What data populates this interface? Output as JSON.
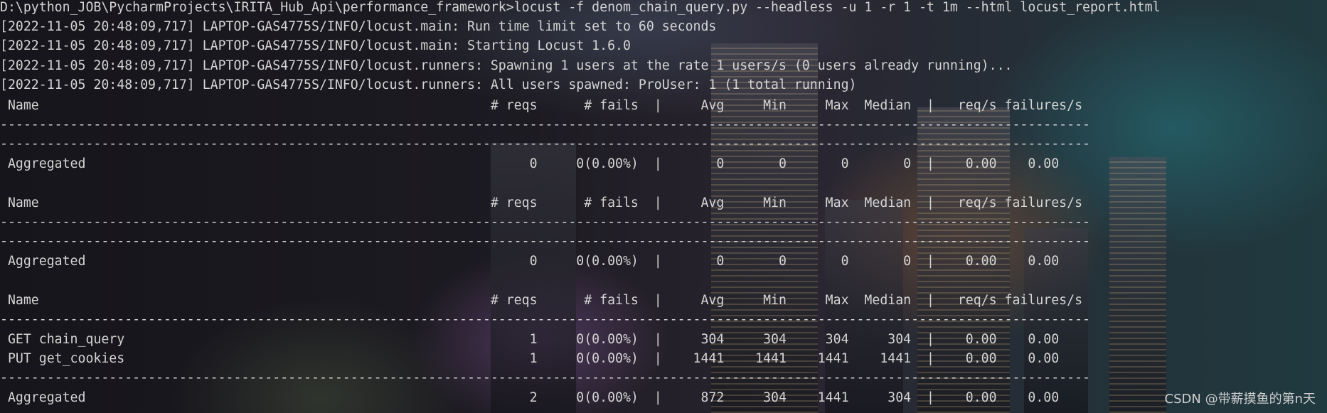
{
  "terminal": {
    "lines": [
      "D:\\python_JOB\\PycharmProjects\\IRITA_Hub_Api\\performance_framework>locust -f denom_chain_query.py --headless -u 1 -r 1 -t 1m --html locust_report.html",
      "[2022-11-05 20:48:09,717] LAPTOP-GAS4775S/INFO/locust.main: Run time limit set to 60 seconds",
      "[2022-11-05 20:48:09,717] LAPTOP-GAS4775S/INFO/locust.main: Starting Locust 1.6.0",
      "[2022-11-05 20:48:09,717] LAPTOP-GAS4775S/INFO/locust.runners: Spawning 1 users at the rate 1 users/s (0 users already running)...",
      "[2022-11-05 20:48:09,717] LAPTOP-GAS4775S/INFO/locust.runners: All users spawned: ProUser: 1 (1 total running)",
      " Name                                                          # reqs      # fails  |     Avg     Min     Max  Median  |   req/s failures/s",
      "--------------------------------------------------------------------------------------------------------------------------------------------",
      "--------------------------------------------------------------------------------------------------------------------------------------------",
      " Aggregated                                                         0     0(0.00%)  |       0       0       0       0  |    0.00    0.00",
      "",
      " Name                                                          # reqs      # fails  |     Avg     Min     Max  Median  |   req/s failures/s",
      "--------------------------------------------------------------------------------------------------------------------------------------------",
      "--------------------------------------------------------------------------------------------------------------------------------------------",
      " Aggregated                                                         0     0(0.00%)  |       0       0       0       0  |    0.00    0.00",
      "",
      " Name                                                          # reqs      # fails  |     Avg     Min     Max  Median  |   req/s failures/s",
      "--------------------------------------------------------------------------------------------------------------------------------------------",
      " GET chain_query                                                    1     0(0.00%)  |     304     304     304     304  |    0.00    0.00",
      " PUT get_cookies                                                    1     0(0.00%)  |    1441    1441    1441    1441  |    0.00    0.00",
      "--------------------------------------------------------------------------------------------------------------------------------------------",
      " Aggregated                                                         2     0(0.00%)  |     872     304    1441     304  |    0.00    0.00"
    ]
  },
  "watermark": "CSDN @带薪摸鱼的第n天"
}
